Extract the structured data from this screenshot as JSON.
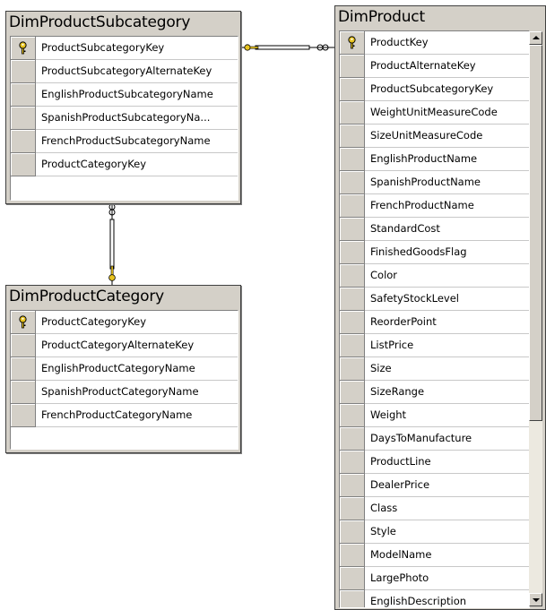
{
  "tables": {
    "subcategory": {
      "title": "DimProductSubcategory",
      "columns": [
        {
          "name": "ProductSubcategoryKey",
          "primary_key": true
        },
        {
          "name": "ProductSubcategoryAlternateKey",
          "primary_key": false
        },
        {
          "name": "EnglishProductSubcategoryName",
          "primary_key": false
        },
        {
          "name": "SpanishProductSubcategoryNa...",
          "primary_key": false
        },
        {
          "name": "FrenchProductSubcategoryName",
          "primary_key": false
        },
        {
          "name": "ProductCategoryKey",
          "primary_key": false
        }
      ]
    },
    "category": {
      "title": "DimProductCategory",
      "columns": [
        {
          "name": "ProductCategoryKey",
          "primary_key": true
        },
        {
          "name": "ProductCategoryAlternateKey",
          "primary_key": false
        },
        {
          "name": "EnglishProductCategoryName",
          "primary_key": false
        },
        {
          "name": "SpanishProductCategoryName",
          "primary_key": false
        },
        {
          "name": "FrenchProductCategoryName",
          "primary_key": false
        }
      ]
    },
    "product": {
      "title": "DimProduct",
      "columns": [
        {
          "name": "ProductKey",
          "primary_key": true
        },
        {
          "name": "ProductAlternateKey",
          "primary_key": false
        },
        {
          "name": "ProductSubcategoryKey",
          "primary_key": false
        },
        {
          "name": "WeightUnitMeasureCode",
          "primary_key": false
        },
        {
          "name": "SizeUnitMeasureCode",
          "primary_key": false
        },
        {
          "name": "EnglishProductName",
          "primary_key": false
        },
        {
          "name": "SpanishProductName",
          "primary_key": false
        },
        {
          "name": "FrenchProductName",
          "primary_key": false
        },
        {
          "name": "StandardCost",
          "primary_key": false
        },
        {
          "name": "FinishedGoodsFlag",
          "primary_key": false
        },
        {
          "name": "Color",
          "primary_key": false
        },
        {
          "name": "SafetyStockLevel",
          "primary_key": false
        },
        {
          "name": "ReorderPoint",
          "primary_key": false
        },
        {
          "name": "ListPrice",
          "primary_key": false
        },
        {
          "name": "Size",
          "primary_key": false
        },
        {
          "name": "SizeRange",
          "primary_key": false
        },
        {
          "name": "Weight",
          "primary_key": false
        },
        {
          "name": "DaysToManufacture",
          "primary_key": false
        },
        {
          "name": "ProductLine",
          "primary_key": false
        },
        {
          "name": "DealerPrice",
          "primary_key": false
        },
        {
          "name": "Class",
          "primary_key": false
        },
        {
          "name": "Style",
          "primary_key": false
        },
        {
          "name": "ModelName",
          "primary_key": false
        },
        {
          "name": "LargePhoto",
          "primary_key": false
        },
        {
          "name": "EnglishDescription",
          "primary_key": false
        }
      ]
    }
  },
  "relationships": [
    {
      "from": "subcategory",
      "to": "product",
      "one_end": "key-icon",
      "many_end": "infinity-icon"
    },
    {
      "from": "category",
      "to": "subcategory",
      "one_end": "key-icon",
      "many_end": "infinity-icon"
    }
  ],
  "colors": {
    "window": "#d4d0c8",
    "grid": "#ffffff",
    "key_gold": "#e8c31f",
    "line": "#000000"
  }
}
